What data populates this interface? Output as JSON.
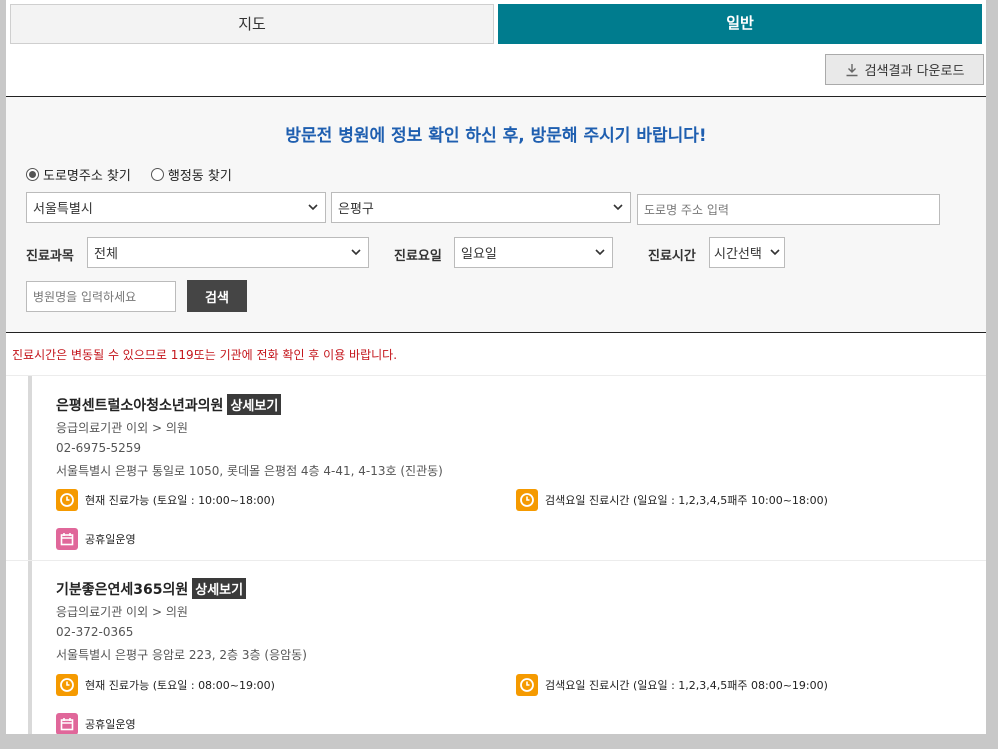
{
  "tabs": {
    "map": "지도",
    "general": "일반"
  },
  "download": {
    "label": "검색결과 다운로드"
  },
  "notice": "방문전 병원에 정보 확인 하신 후, 방문해 주시기 바랍니다!",
  "search": {
    "radio_road": "도로명주소 찾기",
    "radio_admin": "행정동 찾기",
    "city": "서울특별시",
    "district": "은평구",
    "road_placeholder": "도로명 주소 입력",
    "dept_label": "진료과목",
    "dept_value": "전체",
    "day_label": "진료요일",
    "day_value": "일요일",
    "time_label": "진료시간",
    "time_value": "시간선택",
    "name_placeholder": "병원명을 입력하세요",
    "button": "검색"
  },
  "warning": "진료시간은 변동될 수 있으므로 119또는 기관에 전화 확인 후 이용 바랍니다.",
  "results": [
    {
      "name": "은평센트럴소아청소년과의원",
      "detail": "상세보기",
      "category": "응급의료기관 이외 > 의원",
      "phone": "02-6975-5259",
      "address": "서울특별시 은평구 통일로 1050, 롯데몰 은평점 4층 4-41, 4-13호 (진관동)",
      "now_status": "현재 진료가능 (토요일 : 10:00~18:00)",
      "search_status": "검색요일 진료시간 (일요일 : 1,2,3,4,5패주 10:00~18:00)",
      "holiday": "공휴일운영"
    },
    {
      "name": "기분좋은연세365의원",
      "detail": "상세보기",
      "category": "응급의료기관 이외 > 의원",
      "phone": "02-372-0365",
      "address": "서울특별시 은평구 응암로 223, 2층 3층 (응암동)",
      "now_status": "현재 진료가능 (토요일 : 08:00~19:00)",
      "search_status": "검색요일 진료시간 (일요일 : 1,2,3,4,5패주 08:00~19:00)",
      "holiday": "공휴일운영"
    }
  ],
  "colors": {
    "tab_active": "#007c8e",
    "notice": "#1f5fb0",
    "warning": "#c4161c",
    "clock_icon": "#f59a00",
    "calendar_icon": "#e0679a"
  }
}
